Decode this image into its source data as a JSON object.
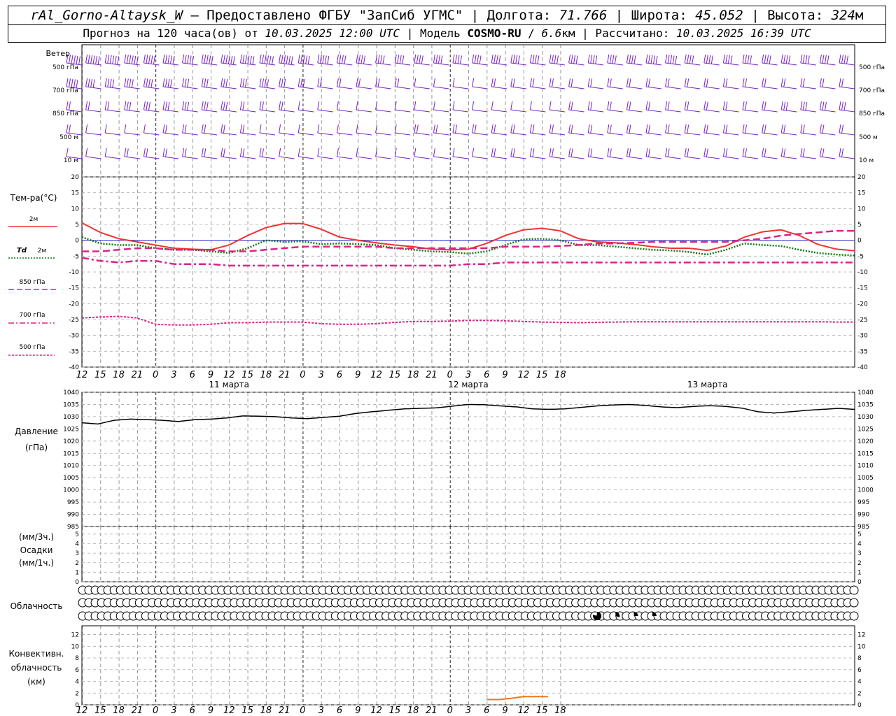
{
  "header": {
    "line1": {
      "station": "rAl_Gorno-Altaysk_W",
      "dash": " – ",
      "provider": "Предоставлено ФГБУ \"ЗапСиб УГМС\"",
      "sep": " | ",
      "lon_label": "Долгота: ",
      "lon_value": "71.766",
      "lat_label": "Широта: ",
      "lat_value": "45.052",
      "alt_label": "Высота: ",
      "alt_value": "324",
      "alt_unit": "м"
    },
    "line2": {
      "forecast_label": "Прогноз на 120 часа(ов) от ",
      "forecast_time": "10.03.2025 12:00 UTC",
      "model_label": " | Модель ",
      "model_name": "COSMO-RU",
      "model_res_sep": " / ",
      "model_res": "6.6",
      "model_res_unit": "км",
      "calc_label": " | Рассчитано: ",
      "calc_time": "10.03.2025 16:39 UTC"
    }
  },
  "chart_data": [
    {
      "type": "barbs",
      "title": "Ветер",
      "levels": [
        "500 гПа",
        "700 гПа",
        "850 гПа",
        "500 м",
        "10  м"
      ],
      "note": "wind barbs per level every 3 h; speeds approximate",
      "speed_ms": {
        "500 гПа": [
          32,
          30,
          28,
          28,
          26,
          25,
          25,
          26,
          28,
          30,
          30,
          28,
          26,
          24,
          22,
          20,
          20,
          20,
          18,
          18,
          18,
          18,
          18,
          18,
          18,
          18,
          20,
          20,
          22,
          22,
          24,
          24,
          22,
          22,
          20,
          20,
          18,
          18,
          18,
          20,
          20
        ],
        "700 гПа": [
          24,
          22,
          20,
          20,
          18,
          18,
          16,
          16,
          16,
          16,
          18,
          16,
          14,
          12,
          10,
          8,
          8,
          8,
          6,
          6,
          6,
          6,
          8,
          8,
          8,
          8,
          8,
          8,
          8,
          8,
          10,
          10,
          10,
          10,
          10,
          12,
          12,
          12,
          12,
          12,
          12
        ],
        "850 гПа": [
          10,
          8,
          12,
          14,
          14,
          14,
          14,
          14,
          14,
          10,
          10,
          8,
          6,
          6,
          6,
          6,
          6,
          6,
          6,
          6,
          6,
          6,
          6,
          6,
          6,
          6,
          8,
          8,
          8,
          10,
          10,
          12,
          12,
          12,
          12,
          12,
          12,
          14,
          14,
          14,
          14
        ],
        "500 м": [
          8,
          6,
          6,
          6,
          6,
          8,
          8,
          8,
          8,
          8,
          6,
          6,
          6,
          6,
          6,
          6,
          6,
          6,
          8,
          8,
          8,
          10,
          10,
          12,
          12,
          12,
          12,
          12,
          12,
          12,
          12,
          12,
          12,
          12,
          12,
          12,
          12,
          12,
          12,
          12,
          12
        ],
        "10  м": [
          4,
          3,
          6,
          8,
          8,
          8,
          8,
          8,
          8,
          8,
          8,
          6,
          6,
          6,
          6,
          6,
          6,
          6,
          6,
          6,
          6,
          6,
          8,
          8,
          8,
          8,
          8,
          8,
          8,
          8,
          8,
          8,
          8,
          8,
          8,
          8,
          8,
          8,
          8,
          8,
          8
        ]
      }
    },
    {
      "type": "line",
      "ylabel": "Тем-ра(°C)",
      "ylim": [
        -40,
        20
      ],
      "yticks": [
        20,
        15,
        10,
        5,
        0,
        -5,
        -10,
        -15,
        -20,
        -25,
        -30,
        -35,
        -40
      ],
      "x": [
        0,
        3,
        6,
        9,
        12,
        15,
        18,
        21,
        24,
        27,
        30,
        33,
        36,
        39,
        42,
        45,
        48,
        51,
        54,
        57,
        60,
        63,
        66,
        69,
        72,
        75,
        78,
        81,
        84,
        87,
        90,
        93,
        96,
        99,
        102,
        105,
        108,
        111,
        114,
        117,
        120
      ],
      "series": [
        {
          "name": "2м",
          "color": "#ee3333",
          "values": [
            5.5,
            2.5,
            0.5,
            -0.5,
            -1.5,
            -2.5,
            -2.8,
            -3.0,
            -1.5,
            1.5,
            4.0,
            5.3,
            5.3,
            3.5,
            1.0,
            0.0,
            -0.8,
            -1.5,
            -2.0,
            -2.8,
            -3.0,
            -2.8,
            -1.0,
            1.5,
            3.3,
            3.8,
            3.0,
            0.5,
            -0.5,
            -0.8,
            -1.3,
            -2.0,
            -2.5,
            -2.5,
            -3.2,
            -1.8,
            1.0,
            2.7,
            3.3,
            1.5,
            -1.3,
            -2.8,
            -3.3
          ]
        },
        {
          "name": "Td 2м",
          "color": "#117711",
          "values": [
            1.0,
            -1.0,
            -1.5,
            -1.5,
            -2.5,
            -3.0,
            -3.0,
            -3.5,
            -4.0,
            -2.5,
            0.0,
            -0.5,
            -0.3,
            -1.2,
            -1.0,
            -1.2,
            -1.5,
            -2.5,
            -3.0,
            -3.5,
            -3.7,
            -4.2,
            -3.5,
            -1.5,
            0.3,
            0.5,
            0.0,
            -1.5,
            -1.5,
            -2.0,
            -2.5,
            -3.0,
            -3.2,
            -3.7,
            -4.5,
            -3.0,
            -1.0,
            -1.5,
            -1.8,
            -3.0,
            -4.0,
            -4.5,
            -4.8
          ]
        },
        {
          "name": "850 гПа",
          "color": "#dd2288",
          "values": [
            -3.5,
            -3.5,
            -3.0,
            -2.5,
            -2.5,
            -3.0,
            -3.0,
            -3.0,
            -3.5,
            -3.5,
            -3.0,
            -2.5,
            -2.0,
            -2.0,
            -2.0,
            -2.0,
            -2.0,
            -2.5,
            -2.5,
            -2.5,
            -2.5,
            -2.5,
            -2.5,
            -2.0,
            -2.0,
            -2.0,
            -1.8,
            -1.5,
            -1.0,
            -1.0,
            -0.8,
            -0.5,
            -0.5,
            -0.5,
            -0.5,
            -0.5,
            0.0,
            0.5,
            1.5,
            2.0,
            2.5,
            3.0,
            3.0
          ]
        },
        {
          "name": "700 гПа",
          "color": "#dd2288",
          "values": [
            -5.5,
            -6.5,
            -7.0,
            -6.5,
            -6.5,
            -7.5,
            -7.5,
            -7.5,
            -8.0,
            -8.0,
            -8.0,
            -8.0,
            -8.0,
            -8.0,
            -8.0,
            -8.0,
            -8.0,
            -8.0,
            -8.0,
            -8.0,
            -8.0,
            -7.5,
            -7.5,
            -7.0,
            -7.0,
            -7.0,
            -7.0,
            -7.0,
            -7.0,
            -7.0,
            -7.0,
            -7.0,
            -7.0,
            -7.0,
            -7.0,
            -7.0,
            -7.0,
            -7.0,
            -7.0,
            -7.0,
            -7.0,
            -7.0,
            -7.0
          ]
        },
        {
          "name": "500 гПа",
          "color": "#dd2288",
          "values": [
            -24.5,
            -24.2,
            -24.0,
            -24.5,
            -26.5,
            -26.7,
            -26.7,
            -26.5,
            -26.0,
            -26.0,
            -25.8,
            -25.8,
            -25.8,
            -26.3,
            -26.5,
            -26.5,
            -26.3,
            -25.9,
            -25.6,
            -25.6,
            -25.5,
            -25.3,
            -25.3,
            -25.4,
            -25.6,
            -25.8,
            -25.9,
            -26.0,
            -25.9,
            -25.8,
            -25.7,
            -25.7,
            -25.7,
            -25.7,
            -25.7,
            -25.7,
            -25.7,
            -25.7,
            -25.7,
            -25.7,
            -25.7,
            -25.8,
            -25.8
          ]
        }
      ]
    },
    {
      "type": "line",
      "ylabel_1": "Давление",
      "ylabel_2": "(гПа)",
      "ylim": [
        985,
        1040
      ],
      "yticks": [
        1040,
        1035,
        1030,
        1025,
        1020,
        1015,
        1010,
        1005,
        1000,
        995,
        990,
        985
      ],
      "series": [
        {
          "name": "Давление",
          "color": "#000000",
          "values": [
            1027.5,
            1027.0,
            1028.5,
            1029.0,
            1028.8,
            1028.5,
            1028.0,
            1028.8,
            1029.0,
            1029.5,
            1030.3,
            1030.2,
            1030.0,
            1029.5,
            1029.2,
            1029.7,
            1030.2,
            1031.3,
            1032.0,
            1032.6,
            1033.2,
            1033.4,
            1033.6,
            1034.3,
            1035.0,
            1034.9,
            1034.4,
            1034.0,
            1033.2,
            1033.0,
            1033.2,
            1033.8,
            1034.4,
            1034.8,
            1035.0,
            1034.6,
            1034.0,
            1033.7,
            1034.2,
            1034.5,
            1034.2,
            1033.5,
            1032.0,
            1031.5,
            1032.0,
            1032.6,
            1033.0,
            1033.4,
            1033.0
          ]
        }
      ]
    },
    {
      "type": "bar",
      "ylabel_1": "(мм/3ч.)",
      "ylabel_2": "Осадки",
      "ylabel_3": "(мм/1ч.)",
      "ylim": [
        0,
        5
      ],
      "yticks": [
        5,
        4,
        3,
        2,
        1,
        0
      ],
      "values": []
    },
    {
      "type": "symbols",
      "ylabel": "Облачность",
      "rows": 3,
      "columns": 41,
      "note": "cloud cover circles per 3 h; lower row partially filled near 09–12 of 12 марта",
      "lower_cover": [
        0,
        0,
        0,
        0,
        0,
        0,
        0,
        0,
        0,
        0,
        0,
        0,
        0,
        0,
        0,
        0,
        0,
        0,
        0,
        0,
        0,
        0,
        0,
        0,
        0,
        0,
        0,
        0,
        0.8,
        0.3,
        0.25,
        0.25,
        0,
        0,
        0,
        0,
        0,
        0,
        0,
        0,
        0
      ]
    },
    {
      "type": "line",
      "ylabel_1": "Конвективн.",
      "ylabel_2": "облачность",
      "ylabel_3": "(км)",
      "ylim": [
        0,
        13
      ],
      "yticks": [
        12,
        10,
        8,
        6,
        4,
        2,
        0
      ],
      "series": [
        {
          "name": "Конвективн. облачность",
          "color": "#ee7722",
          "x": [
            66,
            68,
            70,
            72,
            74,
            76
          ],
          "values": [
            0.9,
            0.9,
            1.1,
            1.4,
            1.4,
            1.4
          ]
        }
      ]
    }
  ],
  "axis": {
    "hour_ticks": [
      "12",
      "15",
      "18",
      "21",
      "0",
      "3",
      "6",
      "9",
      "12",
      "15",
      "18",
      "21",
      "0",
      "3",
      "6",
      "9",
      "12",
      "15",
      "18",
      "21",
      "0",
      "3",
      "6",
      "9",
      "12",
      "15",
      "18"
    ],
    "dates": [
      "11 марта",
      "12 марта",
      "13 марта"
    ]
  },
  "legend": {
    "t2m": "2м",
    "td_main": "Td",
    "td_sub": "2м",
    "t850": "850 гПа",
    "t700": "700 гПа",
    "t500": "500 гПа"
  },
  "wind_labels": {
    "title": "Ветер",
    "l500": "500 гПа",
    "l700": "700 гПа",
    "l850": "850 гПа",
    "l500m": "500 м",
    "l10m": "10  м"
  },
  "colors": {
    "barb": "#7722cc",
    "t2m": "#ee3333",
    "td": "#117711",
    "upper": "#dd2288",
    "convective": "#ee7722",
    "zero_line": "#3333cc"
  }
}
